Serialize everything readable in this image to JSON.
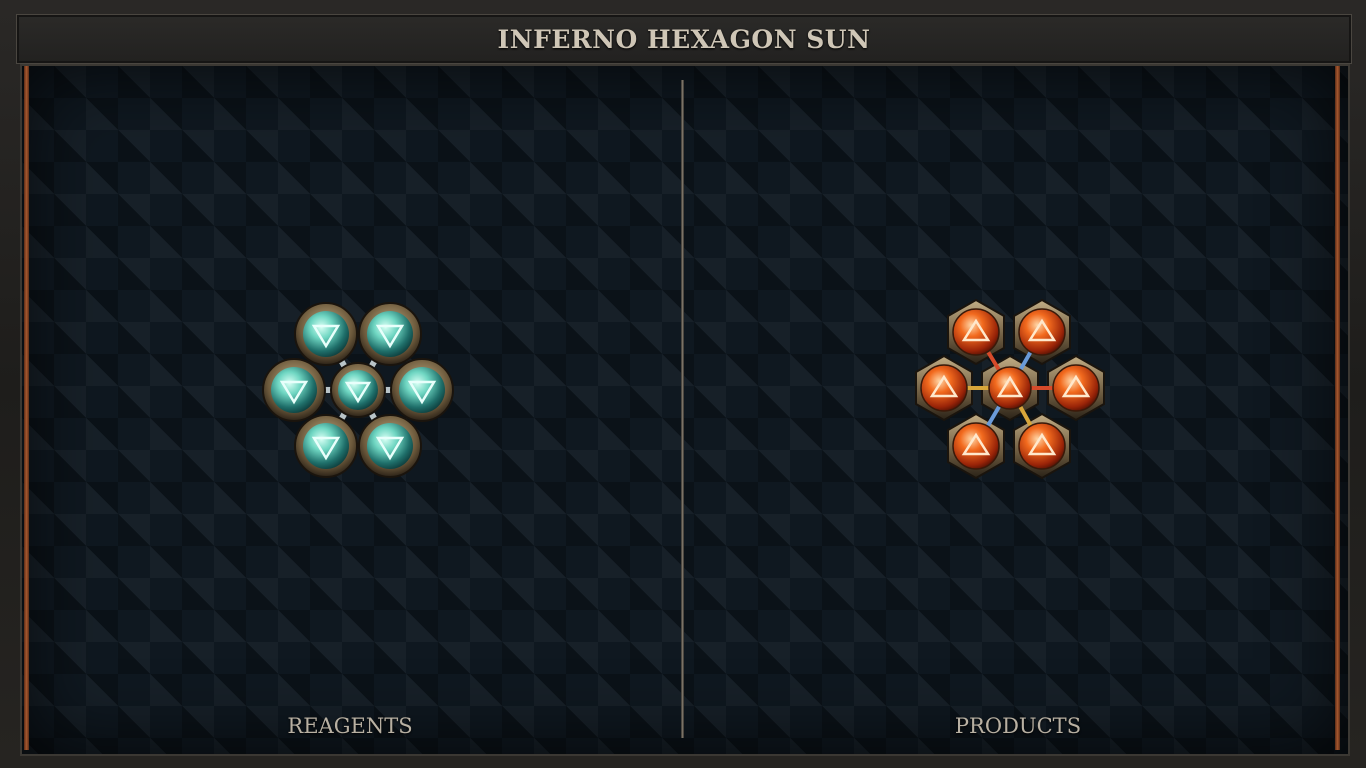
{
  "title": "INFERNO HEXAGON SUN",
  "panels": {
    "left": {
      "label": "REAGENTS",
      "element": "water",
      "glyph": "water-triangle-down-icon",
      "color": "#3fb8a6"
    },
    "right": {
      "label": "PRODUCTS",
      "element": "fire",
      "glyph": "fire-triangle-up-icon",
      "color": "#e85a1a"
    }
  },
  "colors": {
    "board": "#0f1820",
    "frame": "#2a2826",
    "rail": "#a8582e",
    "bronze": "#8a7a5c"
  }
}
